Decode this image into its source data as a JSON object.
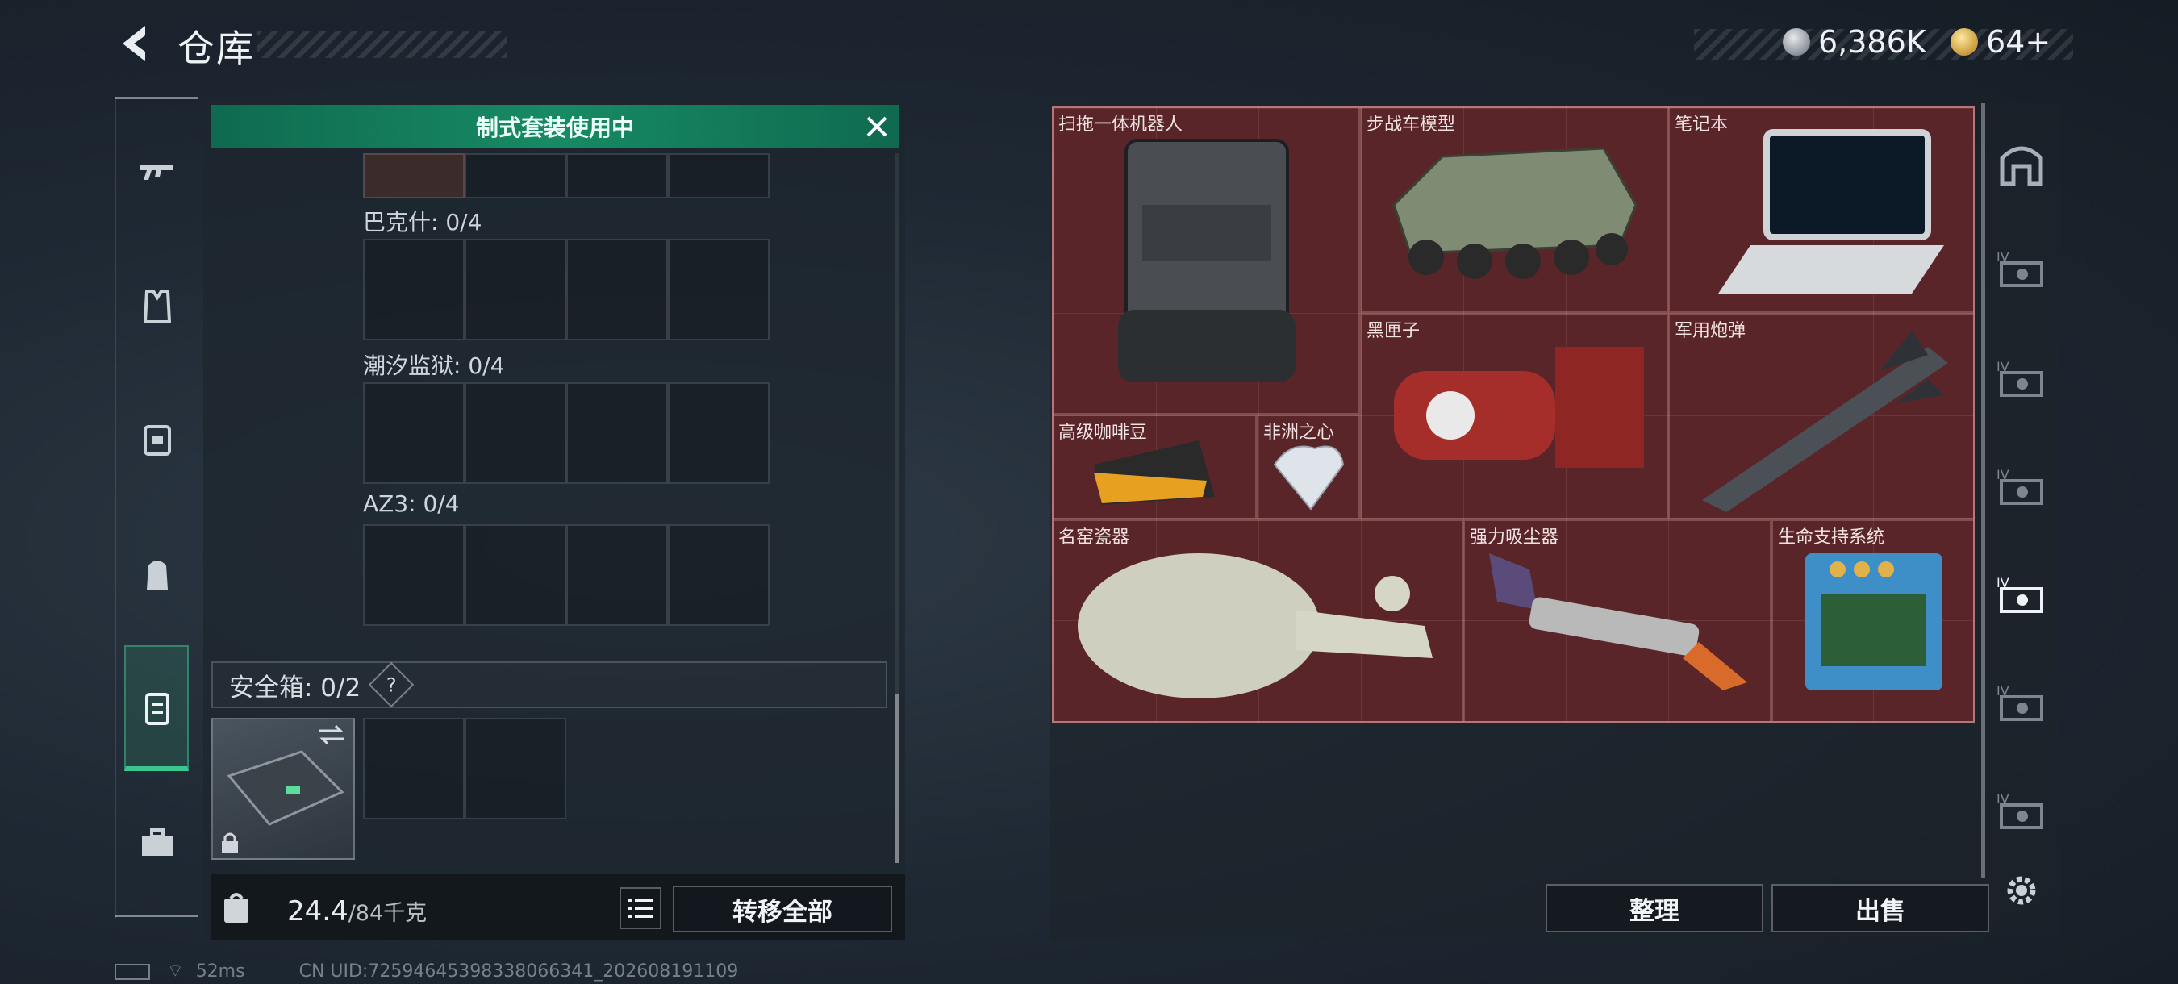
{
  "header": {
    "title": "仓库",
    "currency_1": "6,386K",
    "currency_2": "64+"
  },
  "left_rail": {
    "items": [
      "rifle-icon",
      "armor-vest-icon",
      "chest-rig-icon",
      "backpack-icon",
      "safe-case-icon",
      "toolbox-icon"
    ],
    "active_index": 4
  },
  "loadout": {
    "banner": "制式套装使用中",
    "sections": [
      {
        "label": "巴克什: 0/4"
      },
      {
        "label": "潮汐监狱: 0/4"
      },
      {
        "label": "AZ3: 0/4"
      }
    ],
    "safe_box": {
      "label": "安全箱:  0/2",
      "help": "?"
    },
    "weight": {
      "current": "24.4",
      "max": "/84千克"
    },
    "transfer_all": "转移全部"
  },
  "stash": {
    "items": [
      {
        "name": "扫拖一体机器人"
      },
      {
        "name": "步战车模型"
      },
      {
        "name": "笔记本"
      },
      {
        "name": "黑匣子"
      },
      {
        "name": "军用炮弹"
      },
      {
        "name": "高级咖啡豆"
      },
      {
        "name": "非洲之心"
      },
      {
        "name": "名窑瓷器"
      },
      {
        "name": "强力吸尘器"
      },
      {
        "name": "生命支持系统"
      }
    ],
    "sort_button": "整理",
    "sell_button": "出售"
  },
  "side_tabs": [
    "vault-icon",
    "storage-iv-icon",
    "storage-iv-icon",
    "storage-iv-icon",
    "storage-iv-icon",
    "storage-iv-icon",
    "storage-iv-icon"
  ],
  "status_bar": {
    "ping": "52ms",
    "uid": "CN UID:7259464539833806634​1_202608191109"
  },
  "colors": {
    "accent_green": "#178a64",
    "stash_red": "#5a2529"
  }
}
